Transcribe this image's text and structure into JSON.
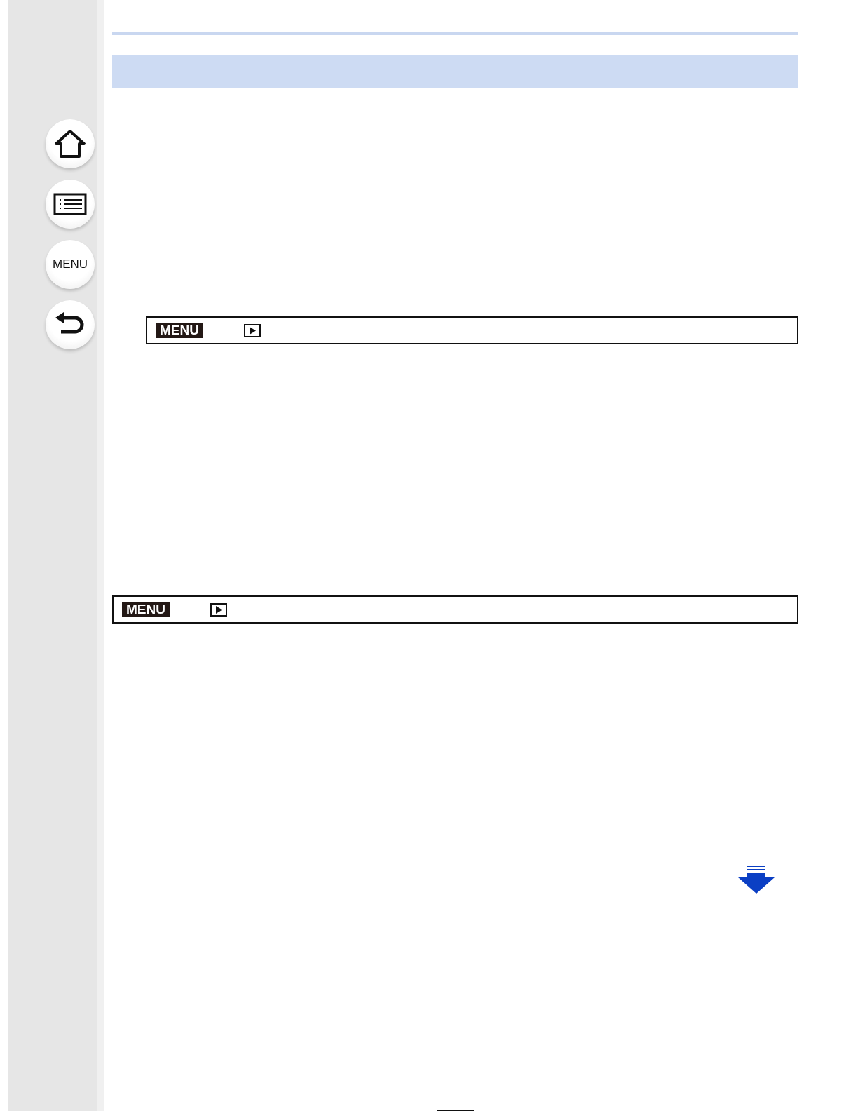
{
  "sidebar": {
    "buttons": [
      {
        "kind": "home"
      },
      {
        "kind": "contents"
      },
      {
        "kind": "menu",
        "label": "MENU"
      },
      {
        "kind": "back"
      }
    ]
  },
  "menu_paths": [
    {
      "badge": "MENU",
      "indented": true
    },
    {
      "badge": "MENU",
      "indented": false
    }
  ]
}
